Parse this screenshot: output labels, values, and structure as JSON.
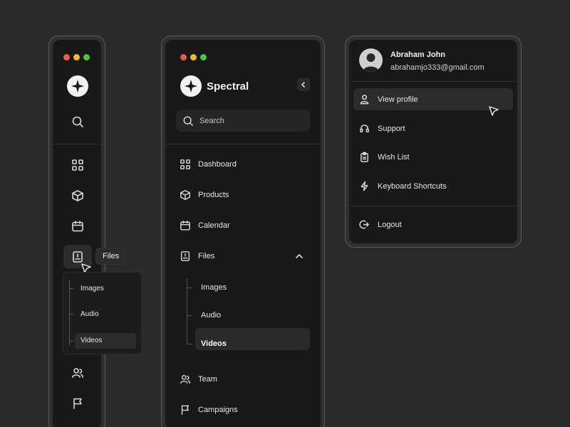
{
  "colors": {
    "background": "#2a2a2a",
    "panel": "#181818",
    "accent_text": "#e6e6e6"
  },
  "collapsed_sidebar": {
    "tooltip": "Files",
    "flyout": {
      "items": [
        "Images",
        "Audio",
        "Videos"
      ],
      "active": "Videos"
    }
  },
  "expanded_sidebar": {
    "brand": "Spectral",
    "search": {
      "placeholder": "Search"
    },
    "nav": [
      {
        "label": "Dashboard",
        "icon": "grid-icon"
      },
      {
        "label": "Products",
        "icon": "box-icon"
      },
      {
        "label": "Calendar",
        "icon": "calendar-icon"
      },
      {
        "label": "Files",
        "icon": "file-icon",
        "expanded": true
      },
      {
        "label": "Team",
        "icon": "users-icon"
      },
      {
        "label": "Campaigns",
        "icon": "flag-icon"
      }
    ],
    "files_children": [
      "Images",
      "Audio",
      "Videos"
    ],
    "active_child": "Videos"
  },
  "profile_menu": {
    "user": {
      "name": "Abraham John",
      "email": "abrahamjo333@gmail.com"
    },
    "items": [
      {
        "label": "View profile",
        "icon": "user-icon",
        "active": true
      },
      {
        "label": "Support",
        "icon": "headset-icon"
      },
      {
        "label": "Wish List",
        "icon": "clipboard-icon"
      },
      {
        "label": "Keyboard Shortcuts",
        "icon": "bolt-icon"
      }
    ],
    "logout": "Logout"
  }
}
